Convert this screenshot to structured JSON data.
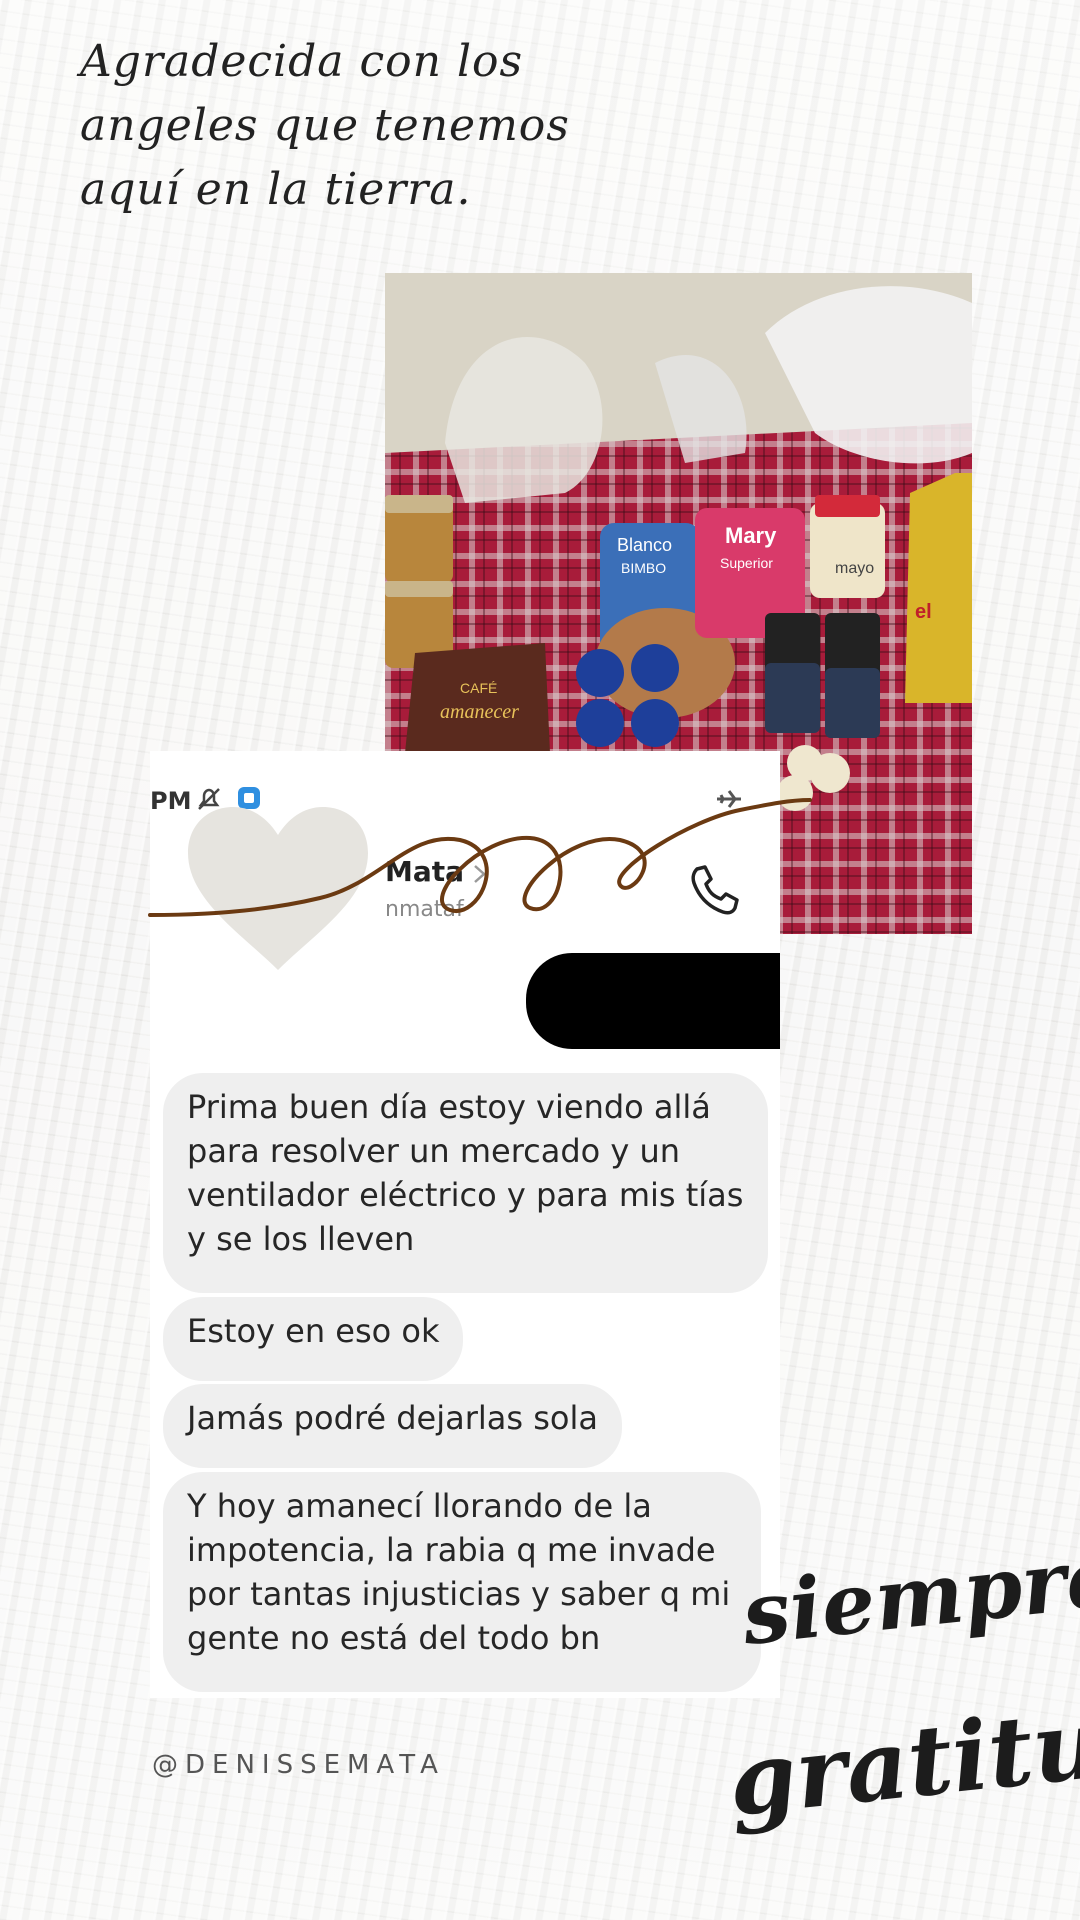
{
  "caption_top": "Agradecida con los angeles que tenemos aquí en la tierra.",
  "screenshot": {
    "status_time": "PM",
    "contact_name": "Mata",
    "contact_username": "nmataf",
    "messages": [
      "Prima buen día estoy viendo allá para resolver un mercado y un ventilador eléctrico y para mis tías y se los lleven",
      "Estoy en eso ok",
      "Jamás podré dejarlas sola",
      "Y hoy amanecí llorando de la impotencia, la rabia q me invade por tantas injusticias y saber q mi gente no está del todo bn"
    ]
  },
  "photo_labels": {
    "bread": "Blanco",
    "bread_brand": "BIMBO",
    "rice": "Mary",
    "rice_sub": "Superior",
    "coffee_top": "CAFÉ",
    "coffee_brand": "amanecer",
    "mayo": "mayo",
    "oil": "el"
  },
  "handle": "@DENISSEMATA",
  "script_line1": "siempre",
  "script_line2": "gratitud",
  "colors": {
    "squiggle": "#6b3a12",
    "heart": "#e6e4df",
    "tablecloth": "#a81c3a",
    "bubble": "#efefef"
  },
  "icons": [
    "mute-icon",
    "app-badge-icon",
    "airplane-icon",
    "chevron-right-icon",
    "phone-icon",
    "heart-sticker"
  ]
}
